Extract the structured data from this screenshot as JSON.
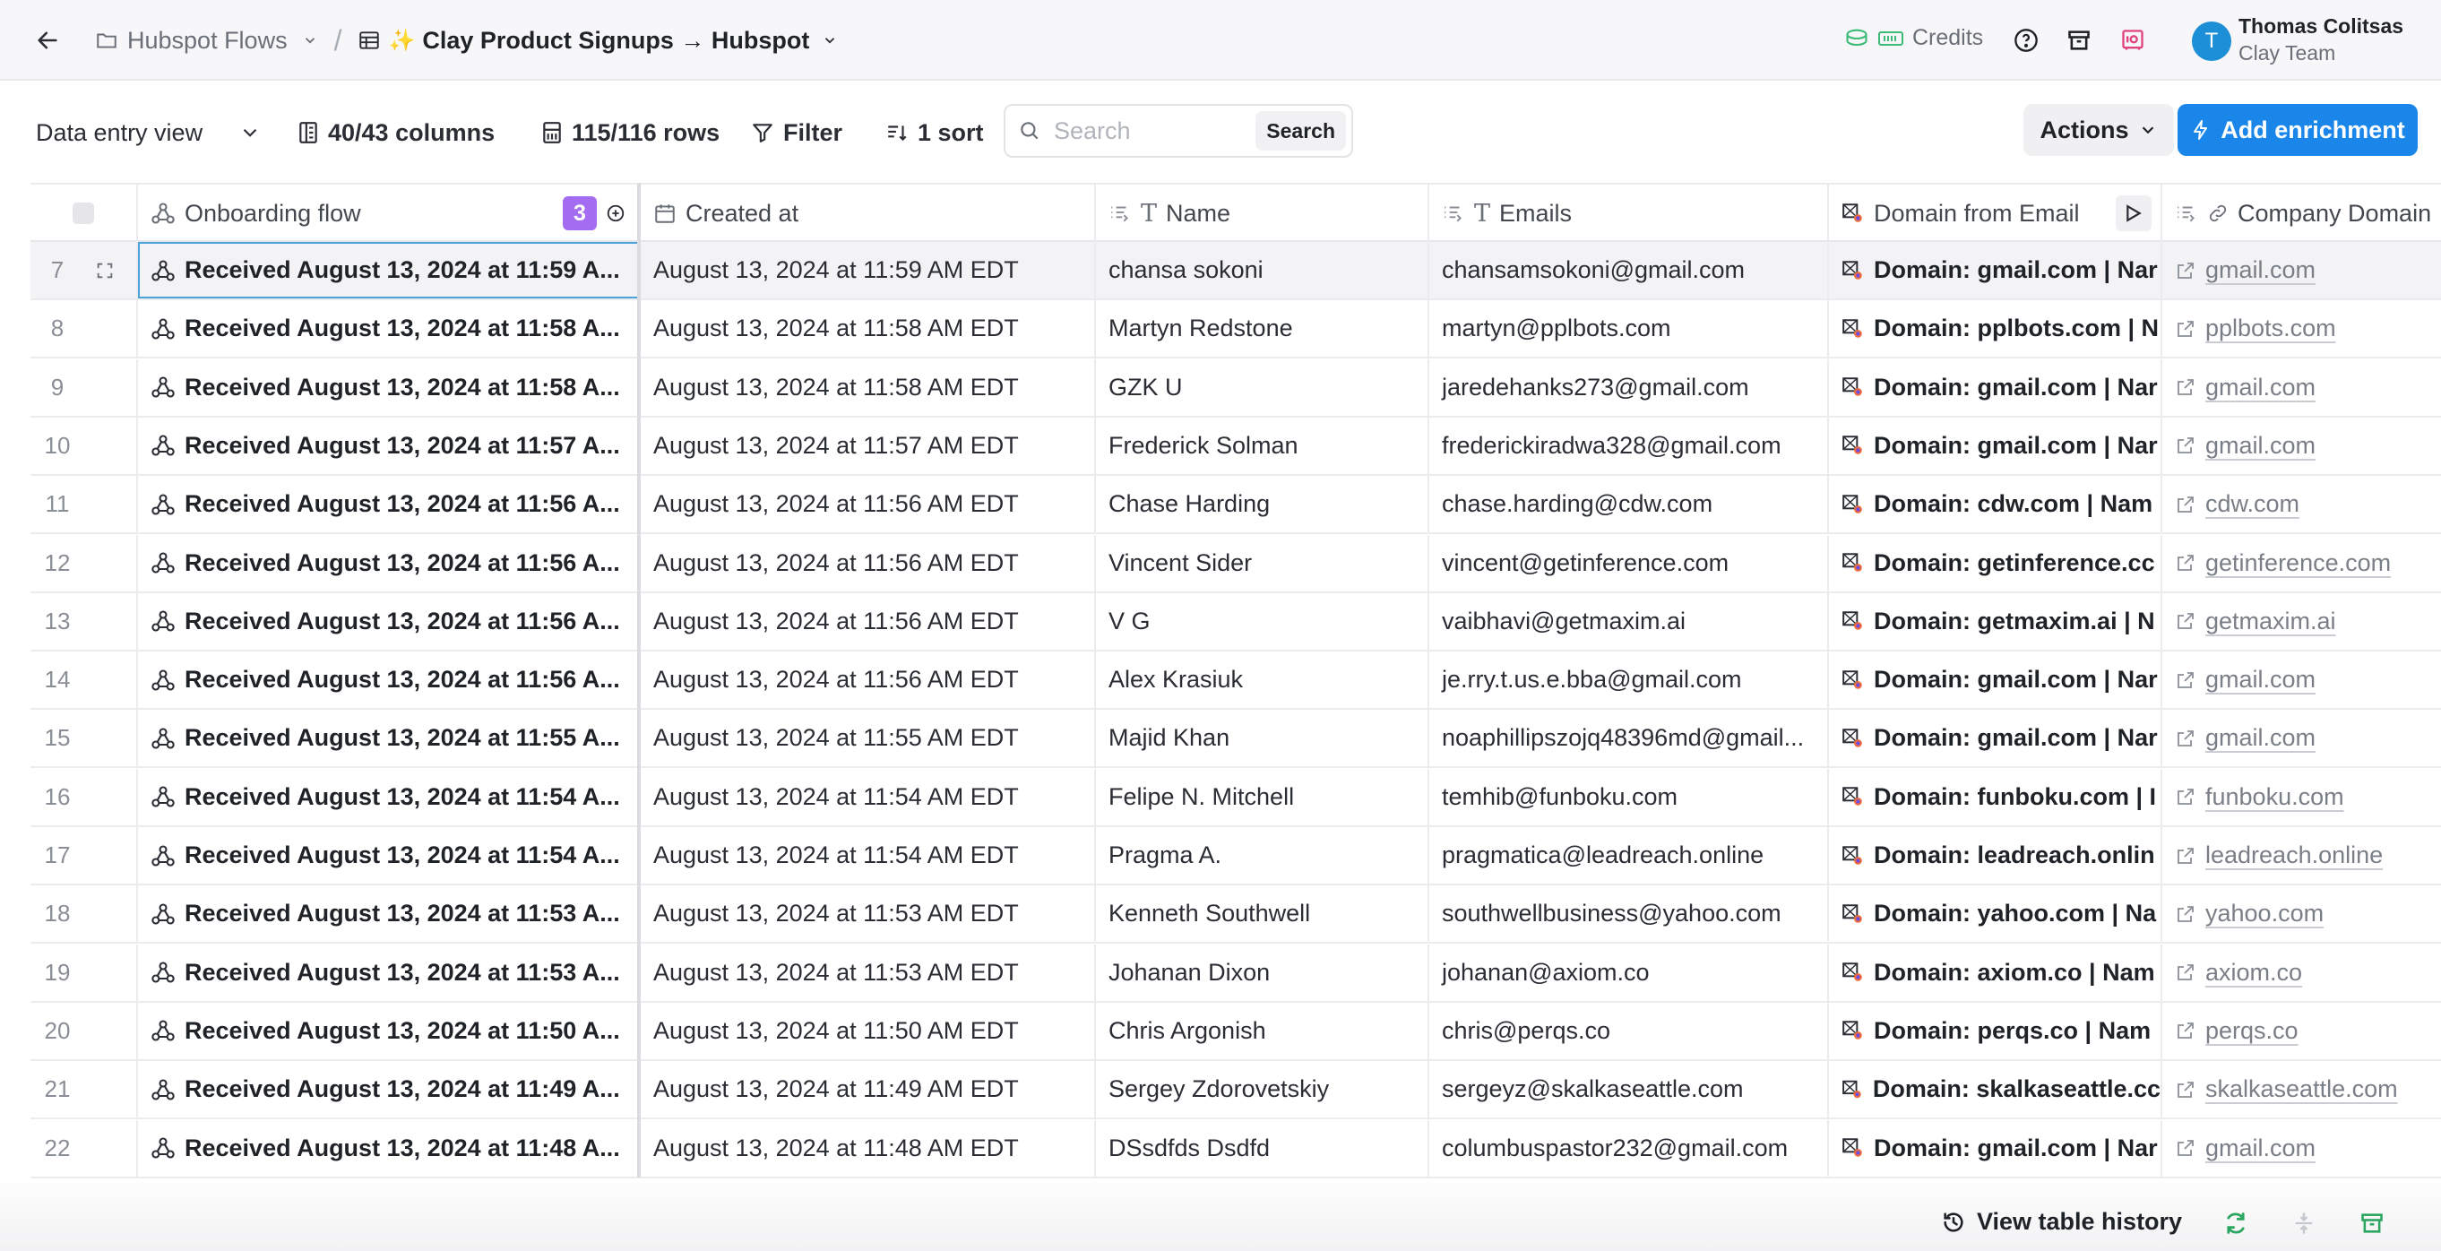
{
  "header": {
    "back_icon": "arrow-left-icon",
    "folder_label": "Hubspot Flows",
    "separator": "/",
    "sparkle": "✨",
    "table_title": "Clay Product Signups → Hubspot",
    "credits_label": "Credits",
    "user_name": "Thomas Colitsas",
    "user_team": "Clay Team",
    "avatar_initial": "T"
  },
  "toolbar": {
    "view_label": "Data entry view",
    "columns_label": "40/43 columns",
    "rows_label": "115/116 rows",
    "filter_label": "Filter",
    "sort_label": "1 sort",
    "search_placeholder": "Search",
    "search_button": "Search",
    "actions_label": "Actions",
    "enrich_label": "Add enrichment",
    "enrich_color": "#1a86ea"
  },
  "table": {
    "columns": [
      {
        "label": "Onboarding flow",
        "badge": "3"
      },
      {
        "label": "Created at"
      },
      {
        "label": "Name"
      },
      {
        "label": "Emails"
      },
      {
        "label": "Domain from Email"
      },
      {
        "label": "Company Domain"
      }
    ],
    "rows": [
      {
        "num": "7",
        "flow": "Received August 13, 2024 at 11:59 A...",
        "created": "August 13, 2024 at 11:59 AM EDT",
        "name": "chansa sokoni",
        "email": "chansamsokoni@gmail.com",
        "domain_email": "Domain: gmail.com | Nar",
        "company": "gmail.com"
      },
      {
        "num": "8",
        "flow": "Received August 13, 2024 at 11:58 A...",
        "created": "August 13, 2024 at 11:58 AM EDT",
        "name": "Martyn Redstone",
        "email": "martyn@pplbots.com",
        "domain_email": "Domain: pplbots.com | N",
        "company": "pplbots.com"
      },
      {
        "num": "9",
        "flow": "Received August 13, 2024 at 11:58 A...",
        "created": "August 13, 2024 at 11:58 AM EDT",
        "name": "GZK U",
        "email": "jaredehanks273@gmail.com",
        "domain_email": "Domain: gmail.com | Nar",
        "company": "gmail.com"
      },
      {
        "num": "10",
        "flow": "Received August 13, 2024 at 11:57 A...",
        "created": "August 13, 2024 at 11:57 AM EDT",
        "name": "Frederick Solman",
        "email": "frederickiradwa328@gmail.com",
        "domain_email": "Domain: gmail.com | Nar",
        "company": "gmail.com"
      },
      {
        "num": "11",
        "flow": "Received August 13, 2024 at 11:56 A...",
        "created": "August 13, 2024 at 11:56 AM EDT",
        "name": "Chase Harding",
        "email": "chase.harding@cdw.com",
        "domain_email": "Domain: cdw.com | Nam",
        "company": "cdw.com"
      },
      {
        "num": "12",
        "flow": "Received August 13, 2024 at 11:56 A...",
        "created": "August 13, 2024 at 11:56 AM EDT",
        "name": "Vincent Sider",
        "email": "vincent@getinference.com",
        "domain_email": "Domain: getinference.cc",
        "company": "getinference.com"
      },
      {
        "num": "13",
        "flow": "Received August 13, 2024 at 11:56 A...",
        "created": "August 13, 2024 at 11:56 AM EDT",
        "name": "V G",
        "email": "vaibhavi@getmaxim.ai",
        "domain_email": "Domain: getmaxim.ai | N",
        "company": "getmaxim.ai"
      },
      {
        "num": "14",
        "flow": "Received August 13, 2024 at 11:56 A...",
        "created": "August 13, 2024 at 11:56 AM EDT",
        "name": "Alex Krasiuk",
        "email": "je.rry.t.us.e.bba@gmail.com",
        "domain_email": "Domain: gmail.com | Nar",
        "company": "gmail.com"
      },
      {
        "num": "15",
        "flow": "Received August 13, 2024 at 11:55 A...",
        "created": "August 13, 2024 at 11:55 AM EDT",
        "name": "Majid Khan",
        "email": "noaphillipszojq48396md@gmail...",
        "domain_email": "Domain: gmail.com | Nar",
        "company": "gmail.com"
      },
      {
        "num": "16",
        "flow": "Received August 13, 2024 at 11:54 A...",
        "created": "August 13, 2024 at 11:54 AM EDT",
        "name": "Felipe N. Mitchell",
        "email": "temhib@funboku.com",
        "domain_email": "Domain: funboku.com | I",
        "company": "funboku.com"
      },
      {
        "num": "17",
        "flow": "Received August 13, 2024 at 11:54 A...",
        "created": "August 13, 2024 at 11:54 AM EDT",
        "name": "Pragma A.",
        "email": "pragmatica@leadreach.online",
        "domain_email": "Domain: leadreach.onlin",
        "company": "leadreach.online"
      },
      {
        "num": "18",
        "flow": "Received August 13, 2024 at 11:53 A...",
        "created": "August 13, 2024 at 11:53 AM EDT",
        "name": "Kenneth Southwell",
        "email": "southwellbusiness@yahoo.com",
        "domain_email": "Domain: yahoo.com | Na",
        "company": "yahoo.com"
      },
      {
        "num": "19",
        "flow": "Received August 13, 2024 at 11:53 A...",
        "created": "August 13, 2024 at 11:53 AM EDT",
        "name": "Johanan Dixon",
        "email": "johanan@axiom.co",
        "domain_email": "Domain: axiom.co | Nam",
        "company": "axiom.co"
      },
      {
        "num": "20",
        "flow": "Received August 13, 2024 at 11:50 A...",
        "created": "August 13, 2024 at 11:50 AM EDT",
        "name": "Chris Argonish",
        "email": "chris@perqs.co",
        "domain_email": "Domain: perqs.co | Nam",
        "company": "perqs.co"
      },
      {
        "num": "21",
        "flow": "Received August 13, 2024 at 11:49 A...",
        "created": "August 13, 2024 at 11:49 AM EDT",
        "name": "Sergey Zdorovetskiy",
        "email": "sergeyz@skalkaseattle.com",
        "domain_email": "Domain: skalkaseattle.cc",
        "company": "skalkaseattle.com"
      },
      {
        "num": "22",
        "flow": "Received August 13, 2024 at 11:48 A...",
        "created": "August 13, 2024 at 11:48 AM EDT",
        "name": "DSsdfds Dsdfd",
        "email": "columbuspastor232@gmail.com",
        "domain_email": "Domain: gmail.com | Nar",
        "company": "gmail.com"
      }
    ]
  },
  "footer": {
    "history_label": "View table history"
  }
}
